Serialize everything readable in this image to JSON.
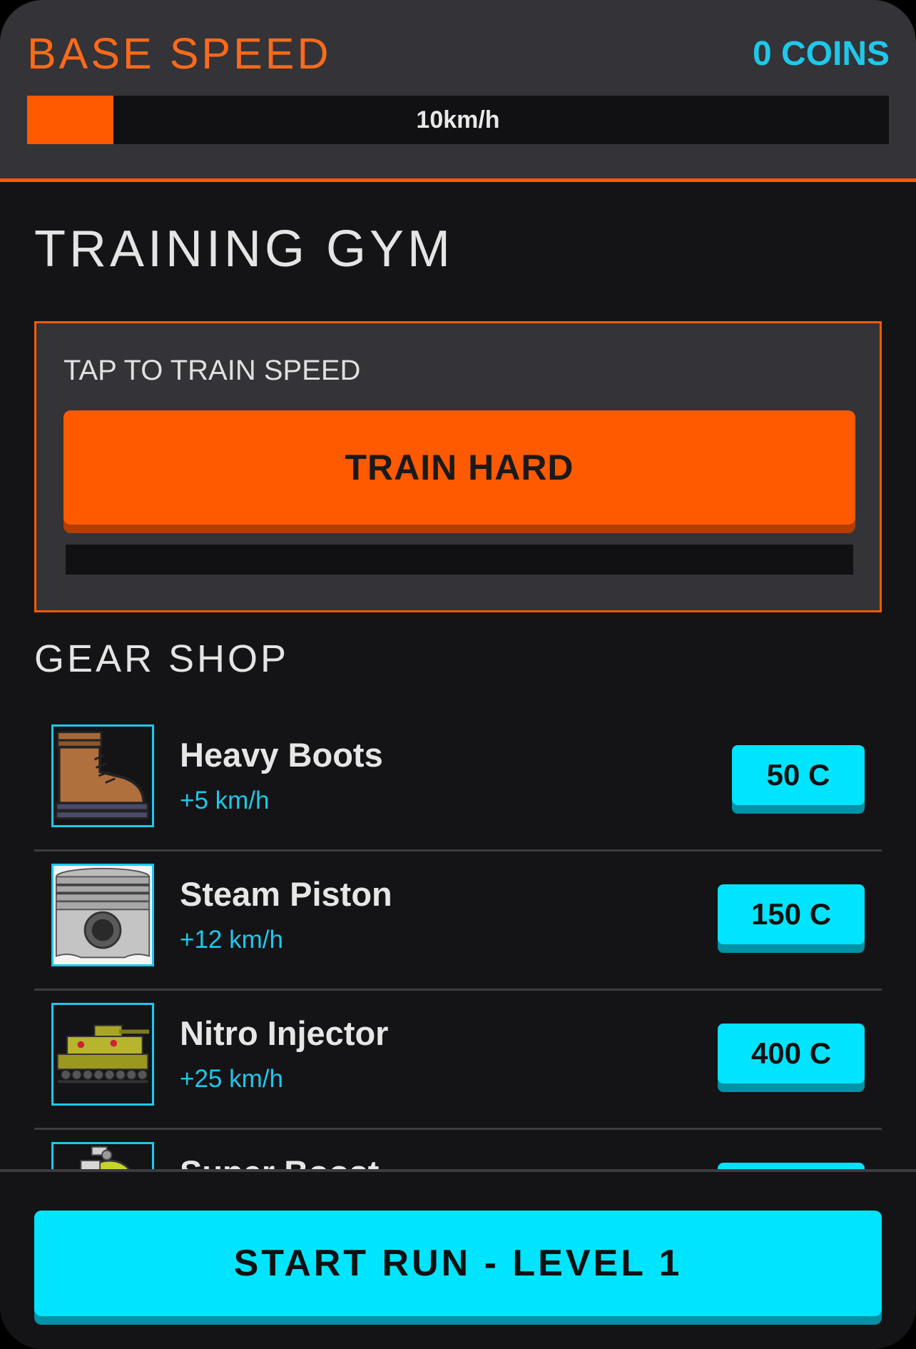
{
  "header": {
    "title": "BASE SPEED",
    "coins": "0 COINS",
    "speed_text": "10km/h",
    "speed_fraction": 0.1
  },
  "gym": {
    "title": "TRAINING GYM",
    "instruction": "TAP TO TRAIN SPEED",
    "button_label": "TRAIN HARD",
    "progress_fraction": 0
  },
  "shop": {
    "title": "GEAR SHOP",
    "items": [
      {
        "name": "Heavy Boots",
        "bonus": "+5 km/h",
        "price": "50 C",
        "icon": "boot-icon"
      },
      {
        "name": "Steam Piston",
        "bonus": "+12 km/h",
        "price": "150 C",
        "icon": "piston-icon"
      },
      {
        "name": "Nitro Injector",
        "bonus": "+25 km/h",
        "price": "400 C",
        "icon": "tank-icon"
      },
      {
        "name": "Super Boost",
        "icon": "robot-icon"
      }
    ]
  },
  "footer": {
    "start_label": "START RUN - LEVEL 1"
  },
  "colors": {
    "accent_orange": "#ff5a00",
    "accent_cyan": "#00e4ff",
    "background": "#141416",
    "panel": "#333338"
  }
}
